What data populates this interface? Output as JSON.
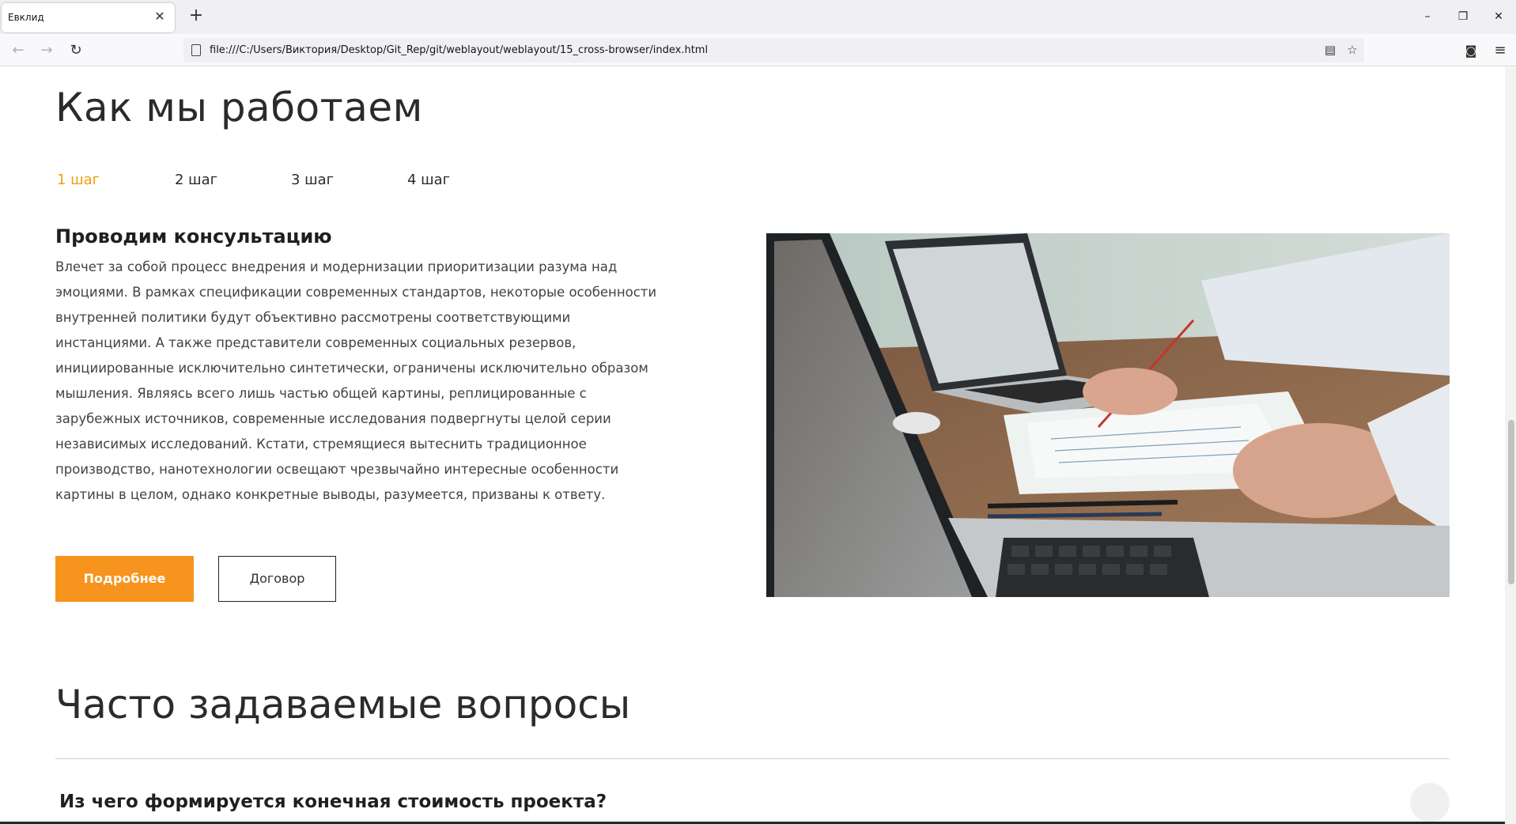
{
  "browser": {
    "tab_title": "Евклид",
    "tab_close": "✕",
    "new_tab": "+",
    "url": "file:///C:/Users/Виктория/Desktop/Git_Rep/git/weblayout/weblayout/15_cross-browser/index.html",
    "window_controls": {
      "minimize": "–",
      "restore": "❐",
      "close": "✕"
    },
    "icons": [
      "back-arrow-icon",
      "forward-arrow-icon",
      "reload-icon",
      "page-icon",
      "reader-view-icon",
      "bookmark-star-icon",
      "pocket-icon",
      "hamburger-menu-icon"
    ]
  },
  "work": {
    "title": "Как мы работаем",
    "steps": [
      "1 шаг",
      "2 шаг",
      "3 шаг",
      "4 шаг"
    ],
    "active_step": 0,
    "step_heading": "Проводим консультацию",
    "step_text": "Влечет за собой процесс внедрения и модернизации приоритизации разума над эмоциями. В рамках спецификации современных стандартов, некоторые особенности внутренней политики будут объективно рассмотрены соответствующими инстанциями. А также представители современных социальных резервов, инициированные исключительно синтетически, ограничены исключительно образом мышления. Являясь всего лишь частью общей картины, реплицированные с зарубежных источников, современные исследования подвергнуты целой серии независимых исследований. Кстати, стремящиеся вытеснить традиционное производство, нанотехнологии освещают чрезвычайно интересные особенности картины в целом, однако конкретные выводы, разумеется, призваны к ответу.",
    "btn_more": "Подробнее",
    "btn_contract": "Договор"
  },
  "faq": {
    "title": "Часто задаваемые вопросы",
    "questions": [
      "Из чего формируется конечная стоимость проекта?"
    ]
  },
  "colors": {
    "accent": "#f7941d",
    "active_step": "#f59e0b"
  }
}
